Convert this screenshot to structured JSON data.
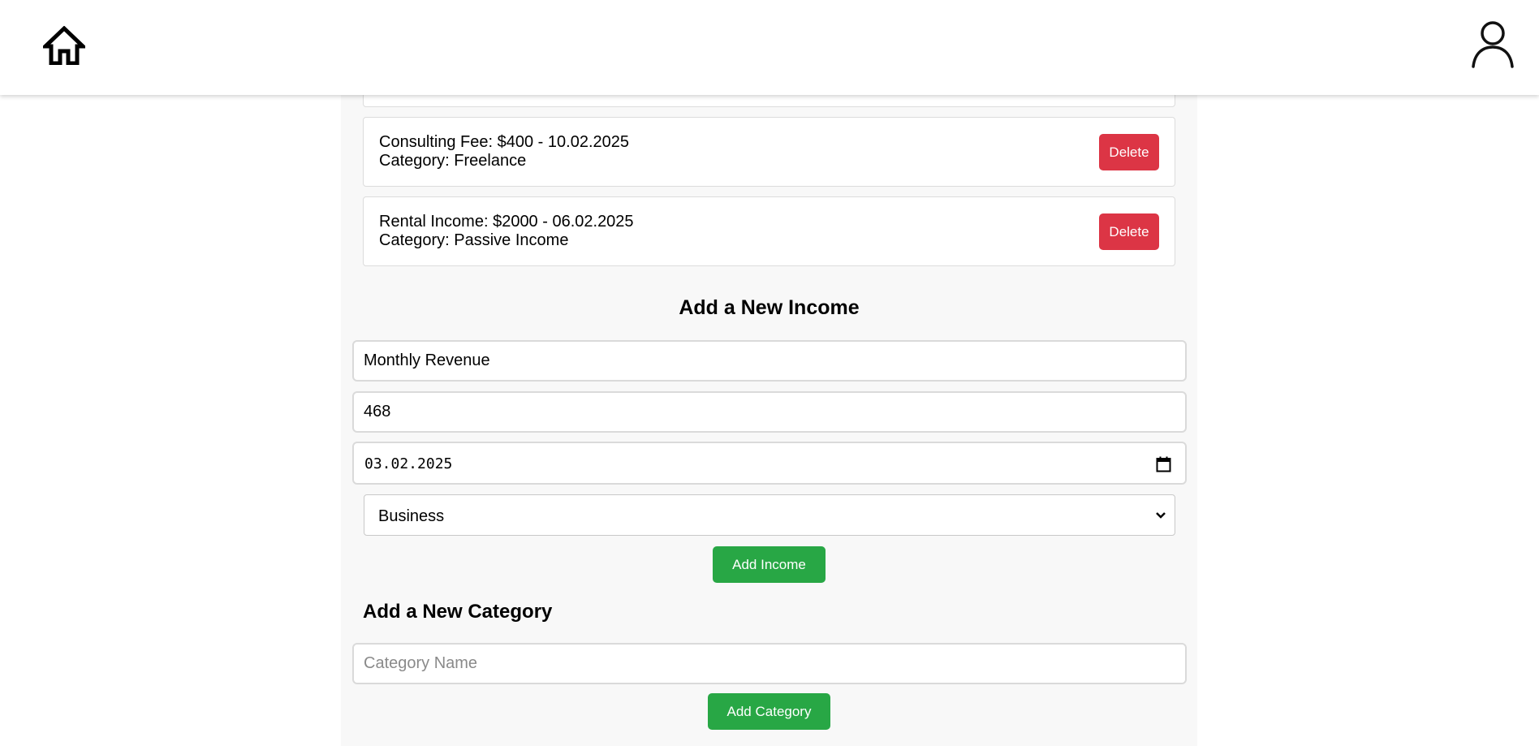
{
  "header": {
    "home_icon": "home-icon",
    "profile_icon": "user-profile-icon"
  },
  "incomes": [
    {
      "title": "Consulting Fee: $400 - 10.02.2025",
      "category": "Category: Freelance",
      "delete_label": "Delete"
    },
    {
      "title": "Rental Income: $2000 - 06.02.2025",
      "category": "Category: Passive Income",
      "delete_label": "Delete"
    }
  ],
  "add_income": {
    "heading": "Add a New Income",
    "name_value": "Monthly Revenue",
    "amount_value": "468",
    "date_value": "03.02.2025",
    "category_selected": "Business",
    "submit_label": "Add Income"
  },
  "add_category": {
    "heading": "Add a New Category",
    "name_value": "",
    "name_placeholder": "Category Name",
    "submit_label": "Add Category"
  },
  "colors": {
    "delete": "#dc3545",
    "primary": "#28a745",
    "panel": "#f8f8f8"
  }
}
